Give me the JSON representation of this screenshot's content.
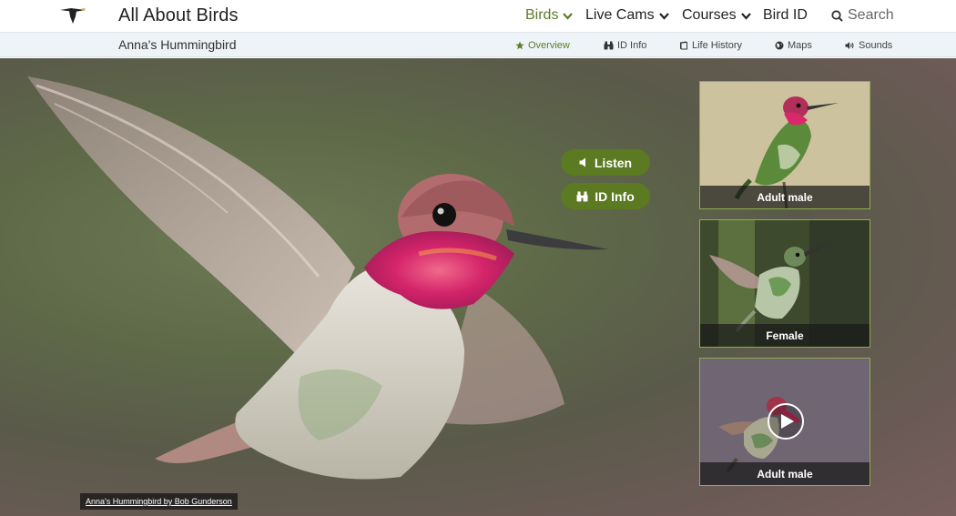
{
  "header": {
    "site_title": "All About Birds",
    "nav": {
      "birds": "Birds",
      "live_cams": "Live Cams",
      "courses": "Courses",
      "bird_id": "Bird ID",
      "search": "Search"
    }
  },
  "subheader": {
    "species": "Anna's Hummingbird",
    "tabs": {
      "overview": "Overview",
      "id_info": "ID Info",
      "life_history": "Life History",
      "maps": "Maps",
      "sounds": "Sounds"
    }
  },
  "hero": {
    "listen_label": "Listen",
    "id_info_label": "ID Info",
    "photo_credit": "Anna's Hummingbird by Bob Gunderson"
  },
  "thumbnails": [
    {
      "caption": "Adult male"
    },
    {
      "caption": "Female"
    },
    {
      "caption": "Adult male"
    }
  ],
  "colors": {
    "accent_green": "#5b7a22",
    "active_nav": "#5c7c26",
    "subbar_bg": "#eef3f8"
  }
}
